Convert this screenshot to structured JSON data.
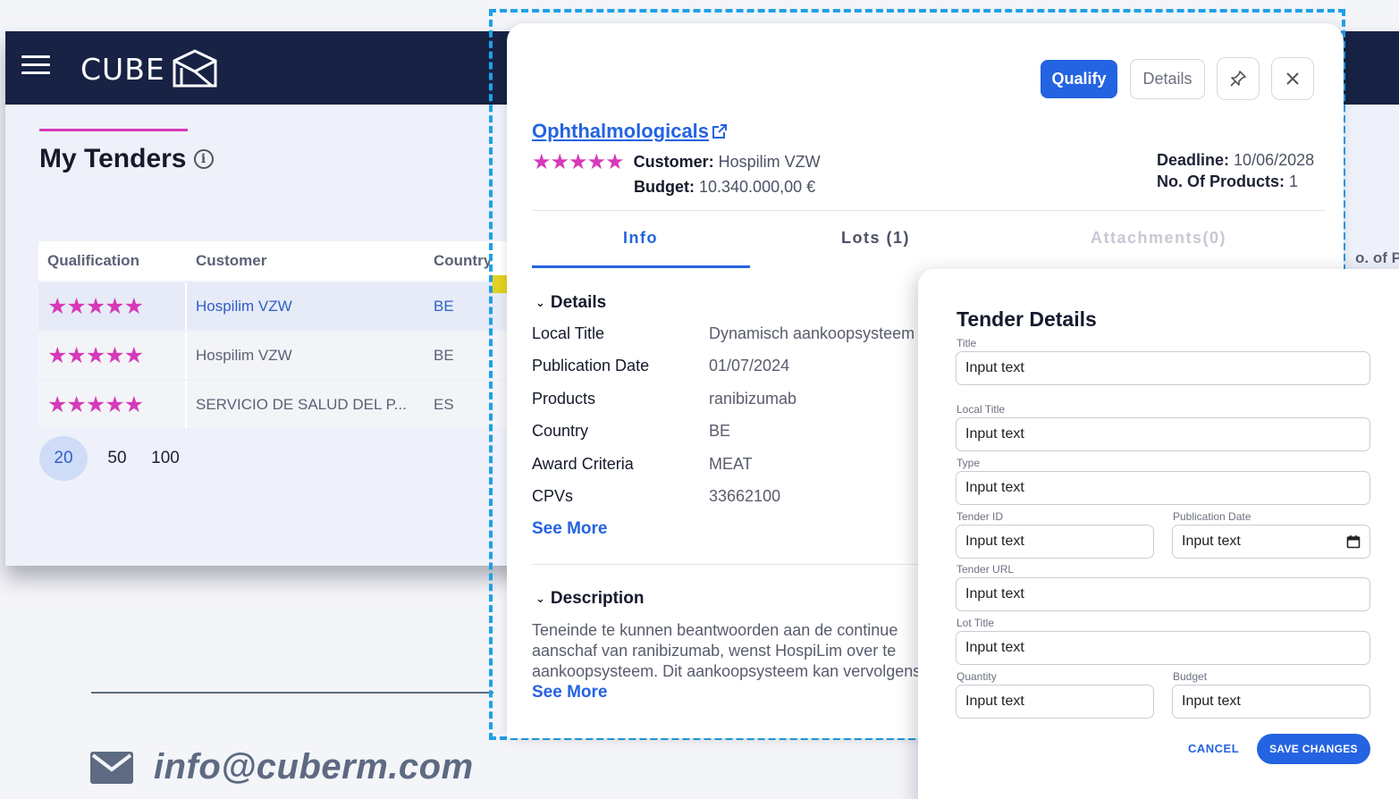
{
  "app": {
    "logo_text": "CUBE",
    "page_title": "My Tenders",
    "info_icon_glyph": "i"
  },
  "table": {
    "headers": [
      "Qualification",
      "Customer",
      "Country"
    ],
    "rows": [
      {
        "stars": "★★★★★",
        "customer": "Hospilim VZW",
        "country": "BE"
      },
      {
        "stars": "★★★★★",
        "customer": "Hospilim VZW",
        "country": "BE"
      },
      {
        "stars": "★★★★★",
        "customer": "SERVICIO DE SALUD DEL P...",
        "country": "ES"
      }
    ],
    "rating": 5,
    "overflow_header": "o. of Pro"
  },
  "pager": {
    "options": [
      "20",
      "50",
      "100"
    ],
    "selected": "20"
  },
  "footer": {
    "email": "info@cuberm.com"
  },
  "popup": {
    "qualify_label": "Qualify",
    "details_label": "Details",
    "pin_icon": "pin-icon",
    "close_icon": "close-icon",
    "tender_title": "Ophthalmologicals",
    "stars": "★★★★★",
    "customer_label": "Customer:",
    "customer_value": "Hospilim VZW",
    "budget_label": "Budget:",
    "budget_value": "10.340.000,00 €",
    "deadline_label": "Deadline:",
    "deadline_value": "10/06/2028",
    "products_label": "No. Of Products:",
    "products_value": "1",
    "tabs": [
      "Info",
      "Lots (1)",
      "Attachments(0)"
    ],
    "details_heading": "Details",
    "details": [
      {
        "k": "Local Title",
        "v": "Dynamisch aankoopsysteem"
      },
      {
        "k": "Publication Date",
        "v": "01/07/2024"
      },
      {
        "k": "Products",
        "v": "ranibizumab"
      },
      {
        "k": "Country",
        "v": "BE"
      },
      {
        "k": "Award Criteria",
        "v": "MEAT"
      },
      {
        "k": "CPVs",
        "v": "33662100"
      }
    ],
    "see_more": "See More",
    "description_heading": "Description",
    "description_lines": [
      "Teneinde te kunnen beantwoorden aan de continue",
      "aanschaf van ranibizumab, wenst HospiLim over te",
      "aankoopsysteem. Dit aankoopsysteem kan vervolgens"
    ]
  },
  "form": {
    "title": "Tender Details",
    "fields": {
      "title": {
        "label": "Title",
        "value": "Input text"
      },
      "local_title": {
        "label": "Local Title",
        "value": "Input text"
      },
      "type": {
        "label": "Type",
        "value": "Input text"
      },
      "tender_id": {
        "label": "Tender ID",
        "value": "Input text"
      },
      "publication_date": {
        "label": "Publication Date",
        "value": "Input text"
      },
      "tender_url": {
        "label": "Tender URL",
        "value": "Input text"
      },
      "lot_title": {
        "label": "Lot Title",
        "value": "Input text"
      },
      "quantity": {
        "label": "Quantity",
        "value": "Input text"
      },
      "budget": {
        "label": "Budget",
        "value": "Input text"
      }
    },
    "cancel_label": "CANCEL",
    "save_label": "SAVE CHANGES"
  },
  "colors": {
    "navy": "#172244",
    "accent_pink": "#d63ab8",
    "primary_blue": "#2463e1",
    "dashed_frame": "#1fa0e8"
  }
}
